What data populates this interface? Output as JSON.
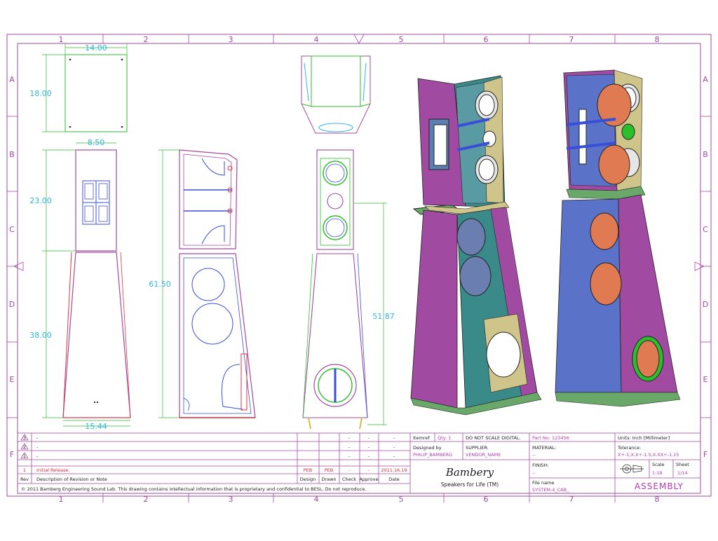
{
  "sheet": {
    "col_labels": [
      "1",
      "2",
      "3",
      "4",
      "5",
      "6",
      "7",
      "8"
    ],
    "row_labels": [
      "A",
      "B",
      "C",
      "D",
      "E",
      "F"
    ],
    "colors": {
      "magenta": "#a14aa2",
      "cyan": "#2fb6e6",
      "green": "#2cbf2c",
      "blue": "#3a4fd8",
      "red": "#e0353b",
      "dark": "#1a1a1a"
    }
  },
  "dimensions": {
    "width_top": "14.00",
    "height_top": "18.00",
    "width_upper": "8.50",
    "height_upper": "23.00",
    "height_lower": "38.00",
    "width_base": "15.44",
    "total_height": "61.50",
    "rear_height": "51.87"
  },
  "revisions": {
    "rows": [
      {
        "rev": "3",
        "desc": "-",
        "design": "",
        "drawn": "",
        "check": "-",
        "approve": "-",
        "date": "-"
      },
      {
        "rev": "2",
        "desc": "-",
        "design": "",
        "drawn": "",
        "check": "-",
        "approve": "-",
        "date": "-"
      },
      {
        "rev": "1",
        "desc": "-",
        "design": "",
        "drawn": "",
        "check": "-",
        "approve": "-",
        "date": "-"
      },
      {
        "rev": "1",
        "desc": "Initial Release.",
        "design": "PEB",
        "drawn": "PEB",
        "check": "-",
        "approve": "-",
        "date": "2011.16.19"
      }
    ],
    "header": {
      "rev": "Rev",
      "desc": "Description of Revision or Note",
      "design": "Design",
      "drawn": "Drawn",
      "check": "Check",
      "approve": "Approve",
      "date": "Date"
    },
    "copyright": "© 2011 Bamberg Engineering Sound Lab. This drawing contains intellectual information that is proprietary and confidential to BESL. Do not reproduce."
  },
  "title_block": {
    "itemref_label": "Itemref",
    "qty": "Qty: 1",
    "no_scale": "DO NOT SCALE DIGITAL.",
    "part_no": "Part No: 123456",
    "units": "Units: Inch [Millimeter]",
    "designed_by_label": "Designed by",
    "designer": "PHILIP_BAMBERG",
    "supplier_label": "SUPPLIER:",
    "supplier": "VENDOR_NAME",
    "material_label": "MATERIAL:",
    "material": "--",
    "tolerance_label": "Tolerance:",
    "tolerance": "X+-1;X.X+-1.5;X.XX+-1.15",
    "logo": "Bambery",
    "tagline": "Speakers for Life (TM)",
    "finish_label": "FINISH:",
    "finish": "--",
    "scale_label": "Scale",
    "scale": "1:18",
    "sheet_label": "Sheet",
    "sheet": "1/14",
    "filename_label": "File name",
    "filename": "SYSTEM-4_CAB_",
    "assembly": "ASSEMBLY"
  }
}
